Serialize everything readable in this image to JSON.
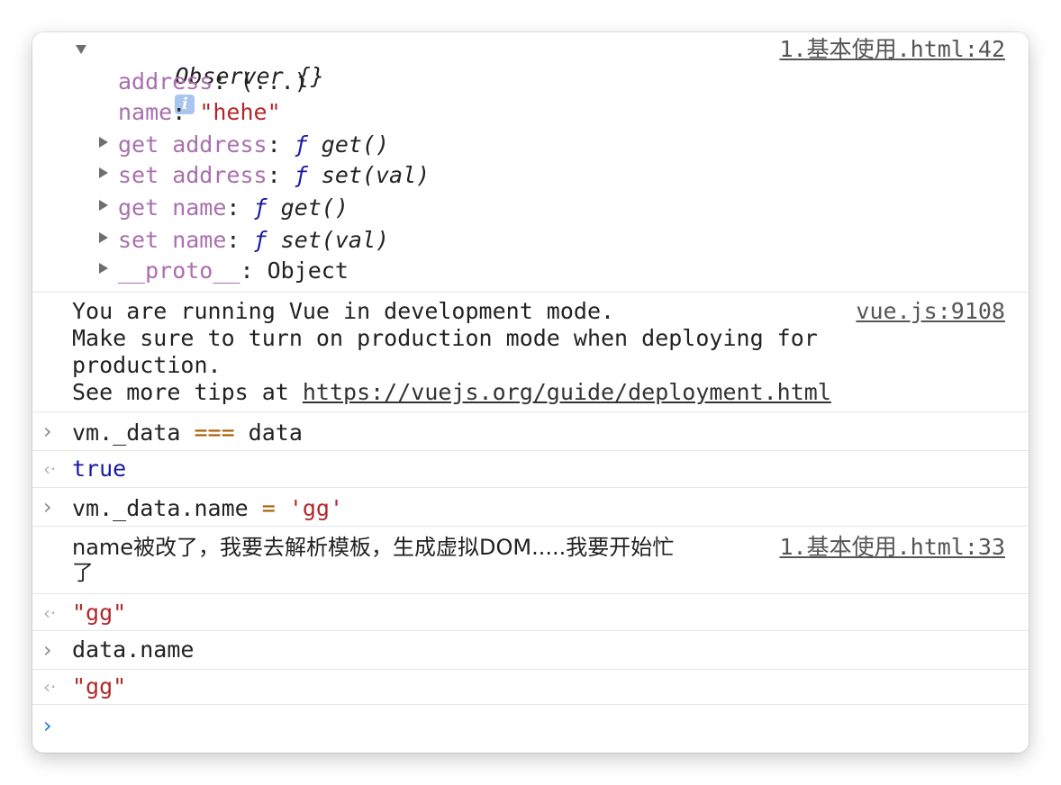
{
  "observer": {
    "title": "Observer {}",
    "info_badge": "i",
    "source": "1.基本使用.html:42",
    "props": [
      {
        "key": "address",
        "sep": ": ",
        "value": "(...)",
        "kind": "plain"
      },
      {
        "key": "name",
        "sep": ": ",
        "value": "\"hehe\"",
        "kind": "string"
      }
    ],
    "accessors": [
      {
        "key": "get address",
        "sep": ": ",
        "f": "ƒ",
        "value": " get()"
      },
      {
        "key": "set address",
        "sep": ": ",
        "f": "ƒ",
        "value": " set(val)"
      },
      {
        "key": "get name",
        "sep": ": ",
        "f": "ƒ",
        "value": " get()"
      },
      {
        "key": "set name",
        "sep": ": ",
        "f": "ƒ",
        "value": " set(val)"
      }
    ],
    "proto": {
      "key": "__proto__",
      "sep": ": ",
      "value": "Object"
    }
  },
  "vue_notice": {
    "source": "vue.js:9108",
    "line1": "You are running Vue in development mode.",
    "line2": "Make sure to turn on production mode when deploying for",
    "line3": "production.",
    "line4_prefix": "See more tips at ",
    "line4_link": "https://vuejs.org/guide/deployment.html"
  },
  "cmd1": {
    "left": "vm._data ",
    "op": "===",
    "right": " data"
  },
  "res1": "true",
  "cmd2": {
    "left": "vm._data.name ",
    "op": "=",
    "right_str": " 'gg'"
  },
  "log2": {
    "line1": "name被改了，我要去解析模板，生成虚拟DOM.....我要开始忙",
    "line2": "了",
    "source": "1.基本使用.html:33"
  },
  "res2": "\"gg\"",
  "cmd3": "data.name",
  "res3": "\"gg\"",
  "icons": {
    "input_chevron": "›",
    "result_chevron": "‹·",
    "prompt_chevron": "›"
  },
  "colors": {
    "property": "#a96fae",
    "string": "#b2282a",
    "keyword": "#1a1aa6",
    "operator": "#a65c00",
    "prompt": "#1a73e8"
  }
}
